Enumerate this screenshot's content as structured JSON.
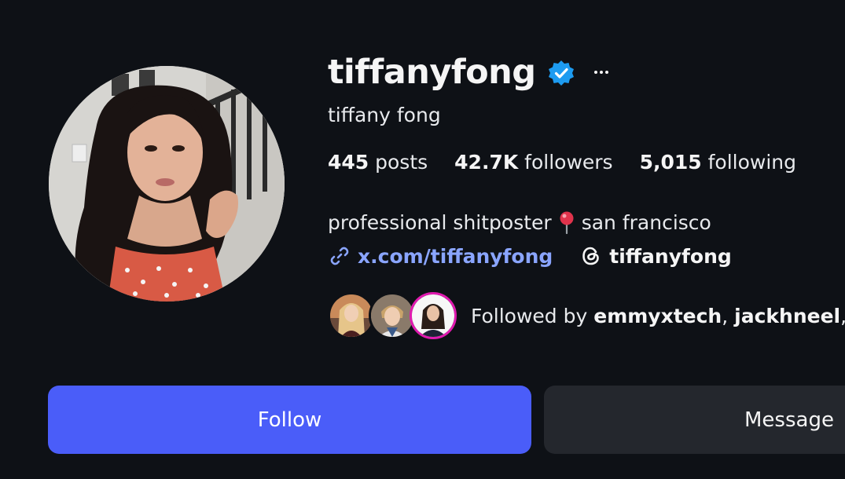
{
  "profile": {
    "username": "tiffanyfong",
    "full_name": "tiffany fong",
    "verified_icon": "verified-badge-icon",
    "more_icon": "more-options-icon",
    "verified_color": "#1d9bf0"
  },
  "stats": {
    "posts_count": "445",
    "posts_label": " posts",
    "followers_count": "42.7K",
    "followers_label": " followers",
    "following_count": "5,015",
    "following_label": " following"
  },
  "bio": {
    "text_before": "professional shitposter",
    "pin_icon": "round-pushpin-icon",
    "text_after": "san francisco"
  },
  "links": {
    "external_icon": "link-icon",
    "external_text": "x.com/tiffanyfong",
    "threads_icon": "threads-icon",
    "threads_text": "tiffanyfong",
    "link_color": "#8aa5ff"
  },
  "followed_by": {
    "prefix": "Followed by ",
    "user_1": "emmyxtech",
    "separator_1": ", ",
    "user_2": "jackhneel",
    "separator_2": ","
  },
  "buttons": {
    "follow_label": "Follow",
    "message_label": "Message",
    "follow_color": "#4a5df9",
    "message_color": "#24272d"
  },
  "theme": {
    "background": "#0e1116"
  }
}
